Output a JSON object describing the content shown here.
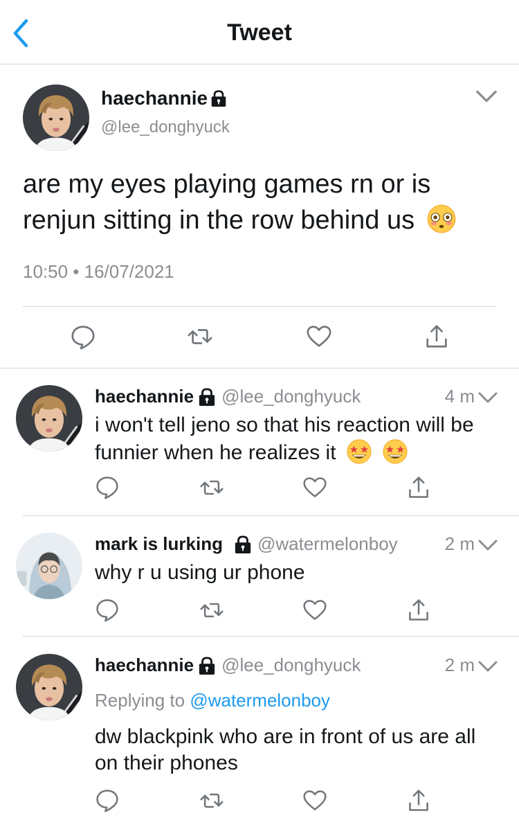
{
  "header": {
    "title": "Tweet",
    "back_icon": "chevron-left-icon"
  },
  "colors": {
    "link": "#1d9bf0",
    "secondary_text": "#8a8d91",
    "divider": "#d3d6d9",
    "icon": "#71767b"
  },
  "main_tweet": {
    "display_name": "haechannie",
    "handle": "@lee_donghyuck",
    "text": "are my eyes playing games rn or is renjun sitting in the row behind us",
    "emoji": "flushed-face",
    "timestamp": "10:50 • 16/07/2021"
  },
  "replies": [
    {
      "display_name": "haechannie",
      "handle": "@lee_donghyuck",
      "time": "4 m",
      "text": "i won't tell jeno so that his reaction will be funnier when he realizes it",
      "emoji": [
        "star-struck-face",
        "star-struck-face"
      ]
    },
    {
      "display_name": "mark is lurking",
      "handle": "@watermelonboy",
      "time": "2 m",
      "text": "why r u using ur phone"
    },
    {
      "display_name": "haechannie",
      "handle": "@lee_donghyuck",
      "time": "2 m",
      "replying_prefix": "Replying to",
      "replying_to": "@watermelonboy",
      "text": "dw blackpink who are in front of us are all on their phones"
    }
  ]
}
